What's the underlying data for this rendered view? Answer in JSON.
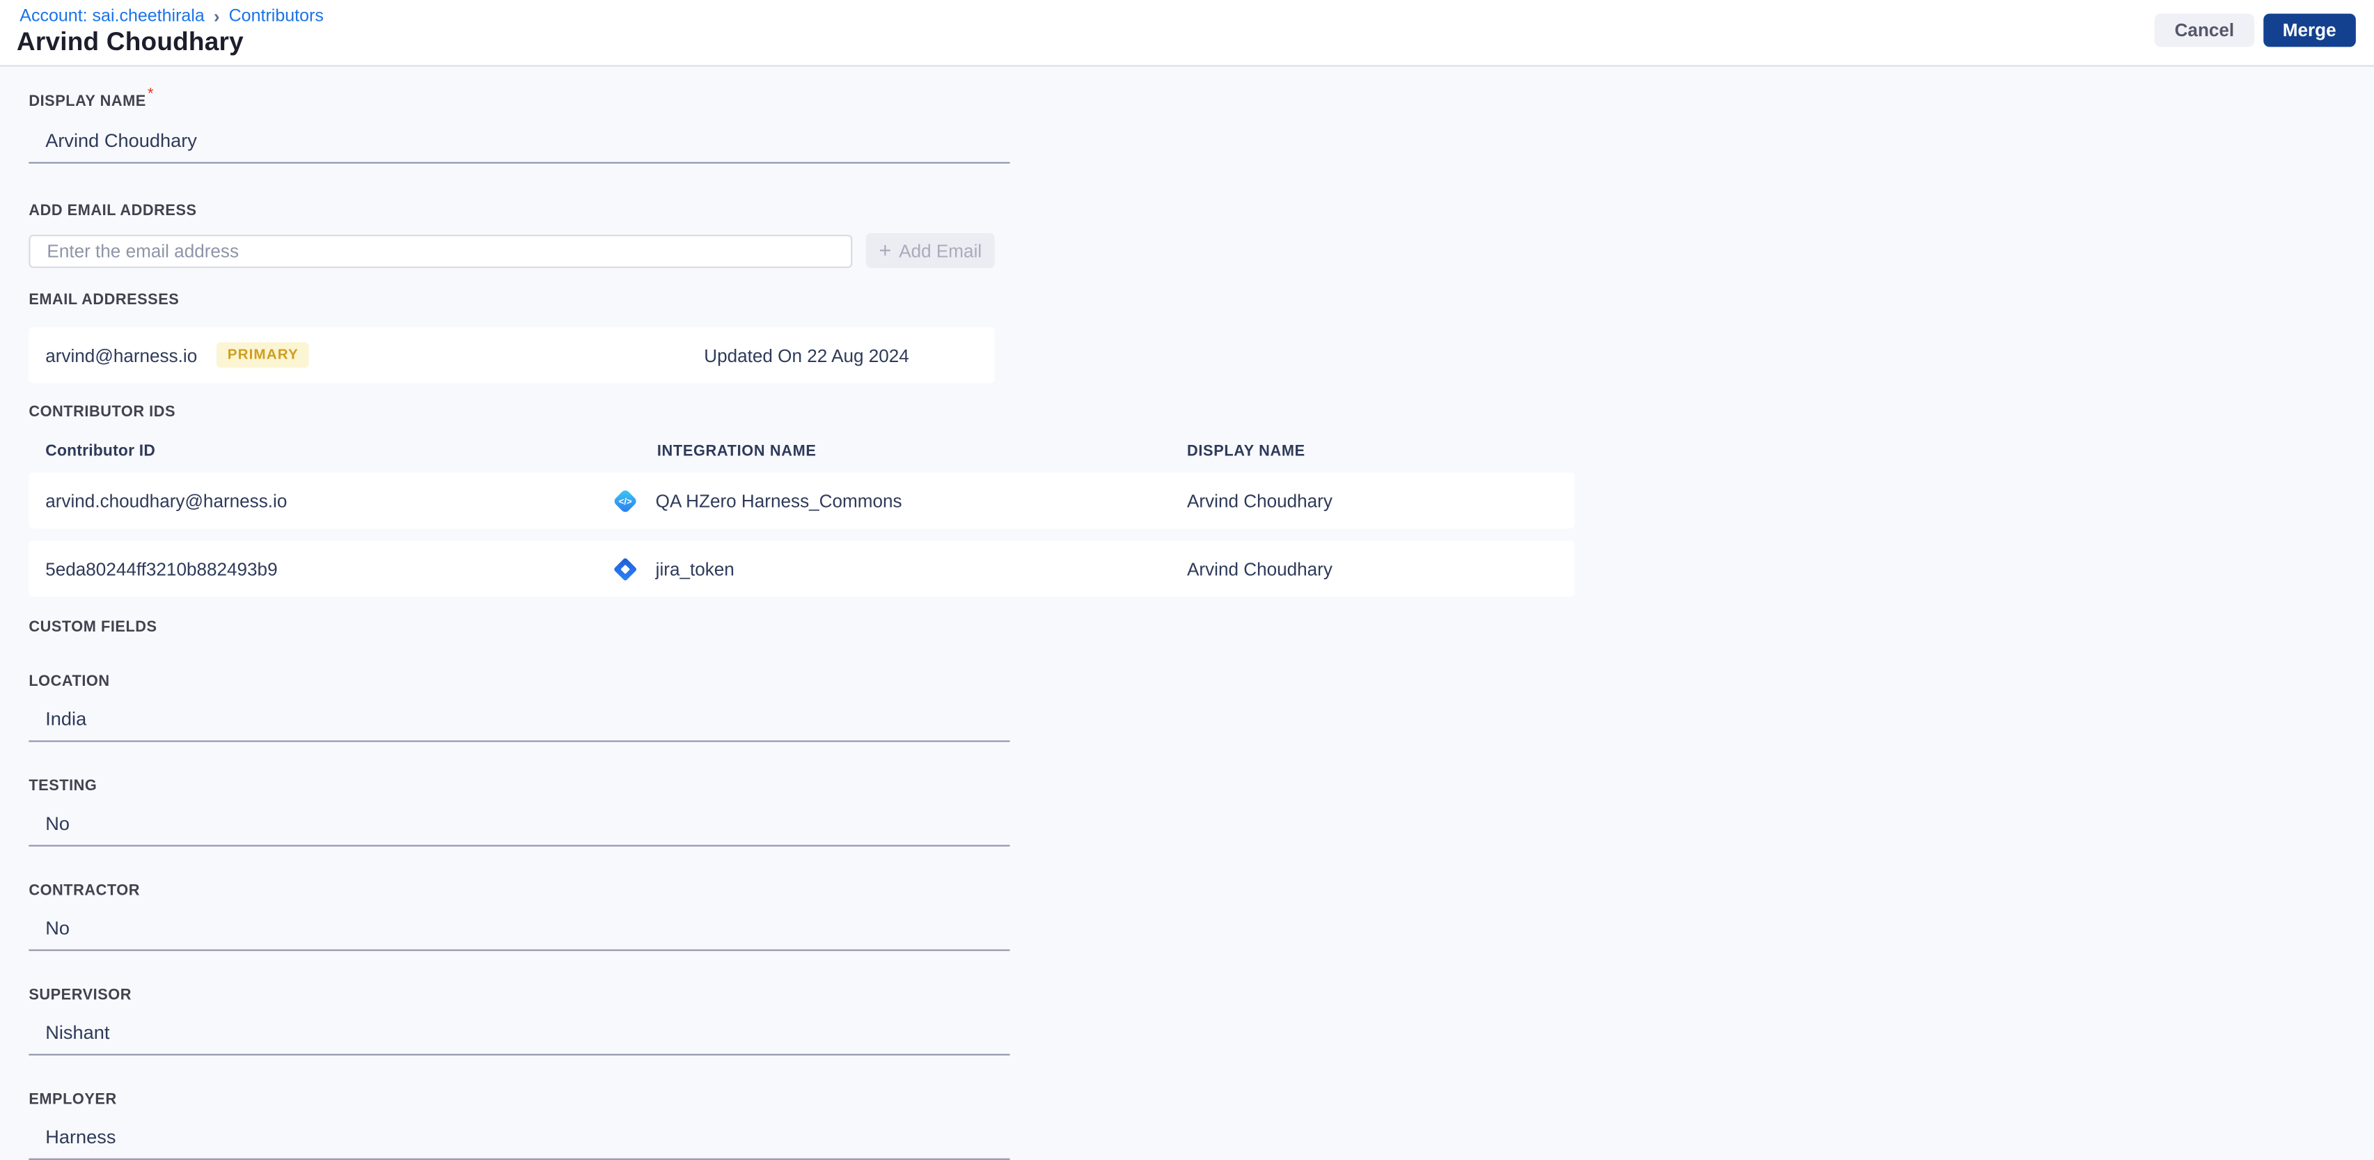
{
  "breadcrumb": {
    "account_link": "Account: sai.cheethirala",
    "separator": "›",
    "contributors_link": "Contributors"
  },
  "header": {
    "title": "Arvind Choudhary",
    "cancel_label": "Cancel",
    "merge_label": "Merge"
  },
  "display_name": {
    "label": "DISPLAY NAME",
    "required_marker": "*",
    "value": "Arvind Choudhary"
  },
  "add_email": {
    "label": "ADD EMAIL ADDRESS",
    "placeholder": "Enter the email address",
    "plus_icon": "+",
    "button_label": "Add Email"
  },
  "email_addresses": {
    "label": "EMAIL ADDRESSES",
    "items": [
      {
        "email": "arvind@harness.io",
        "badge": "PRIMARY",
        "updated": "Updated On 22 Aug 2024"
      }
    ]
  },
  "contributor_ids": {
    "label": "CONTRIBUTOR IDS",
    "columns": [
      "Contributor ID",
      "INTEGRATION NAME",
      "DISPLAY NAME"
    ],
    "rows": [
      {
        "id": "arvind.choudhary@harness.io",
        "integration_icon": "code-integration-icon",
        "integration": "QA HZero Harness_Commons",
        "display_name": "Arvind Choudhary"
      },
      {
        "id": "5eda80244ff3210b882493b9",
        "integration_icon": "jira-icon",
        "integration": "jira_token",
        "display_name": "Arvind Choudhary"
      }
    ]
  },
  "custom_fields": {
    "label": "CUSTOM FIELDS",
    "fields": [
      {
        "label": "LOCATION",
        "value": "India"
      },
      {
        "label": "TESTING",
        "value": "No"
      },
      {
        "label": "CONTRACTOR",
        "value": "No"
      },
      {
        "label": "SUPERVISOR",
        "value": "Nishant"
      },
      {
        "label": "EMPLOYER",
        "value": "Harness"
      }
    ]
  },
  "colors": {
    "accent_link": "#1a73e8",
    "merge_bg": "#14418f",
    "merge_text": "#ffffff",
    "cancel_bg": "#f0f1f6",
    "cancel_text": "#54576a",
    "badge_bg": "#fcf5d4",
    "badge_text": "#cf9f1d",
    "page_bg": "#f8f9fd",
    "header_bg": "#ffffff",
    "text_primary": "#2e3a59",
    "label_color": "#42424f",
    "underline_color": "#9196ad",
    "border_color": "#dcdde8"
  }
}
